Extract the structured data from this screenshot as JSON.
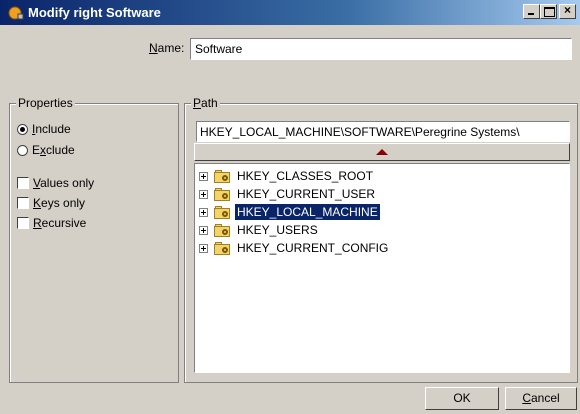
{
  "window": {
    "title": "Modify right Software"
  },
  "name": {
    "label_prefix": "N",
    "label_rest": "ame:",
    "value": "Software"
  },
  "properties": {
    "legend": "Properties",
    "include_label_u": "I",
    "include_label_rest": "nclude",
    "exclude_label_pre": "E",
    "exclude_label_u": "x",
    "exclude_label_rest": "clude",
    "selected": "include",
    "values_only_u": "V",
    "values_only_rest": "alues only",
    "keys_only_u": "K",
    "keys_only_rest": "eys only",
    "recursive_u": "R",
    "recursive_rest": "ecursive"
  },
  "path": {
    "legend_u": "P",
    "legend_rest": "ath",
    "value": "HKEY_LOCAL_MACHINE\\SOFTWARE\\Peregrine Systems\\",
    "tree": [
      {
        "label": "HKEY_CLASSES_ROOT"
      },
      {
        "label": "HKEY_CURRENT_USER"
      },
      {
        "label": "HKEY_LOCAL_MACHINE"
      },
      {
        "label": "HKEY_USERS"
      },
      {
        "label": "HKEY_CURRENT_CONFIG"
      }
    ],
    "selected_index": 2
  },
  "buttons": {
    "ok": "OK",
    "cancel_u": "C",
    "cancel_rest": "ancel"
  }
}
